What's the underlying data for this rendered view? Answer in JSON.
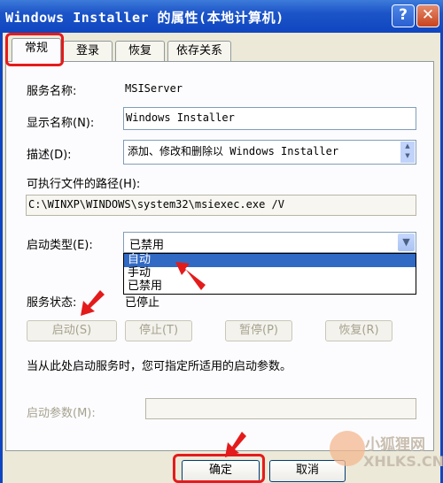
{
  "window": {
    "title": "Windows Installer 的属性(本地计算机)",
    "help_label": "?",
    "close_label": "✕"
  },
  "tabs": [
    "常规",
    "登录",
    "恢复",
    "依存关系"
  ],
  "general": {
    "service_name_label": "服务名称:",
    "service_name_value": "MSIServer",
    "display_name_label": "显示名称(N):",
    "display_name_value": "Windows Installer",
    "description_label": "描述(D):",
    "description_value": "添加、修改和删除以 Windows Installer",
    "exe_path_label": "可执行文件的路径(H):",
    "exe_path_value": "C:\\WINXP\\WINDOWS\\system32\\msiexec.exe /V",
    "startup_type_label": "启动类型(E):",
    "startup_type_value": "已禁用",
    "startup_options": [
      "自动",
      "手动",
      "已禁用"
    ],
    "status_label": "服务状态:",
    "status_value": "已停止",
    "buttons": {
      "start": "启动(S)",
      "stop": "停止(T)",
      "pause": "暂停(P)",
      "resume": "恢复(R)"
    },
    "hint": "当从此处启动服务时，您可指定所适用的启动参数。",
    "params_label": "启动参数(M):",
    "params_value": ""
  },
  "footer": {
    "ok": "确定",
    "cancel": "取消"
  },
  "watermark": {
    "cn": "小狐狸网",
    "en": "XHLKS.CN"
  },
  "colors": {
    "titlebar": "#0f46c0",
    "highlight": "#316ac5",
    "annotation_red": "#e41b1b"
  }
}
